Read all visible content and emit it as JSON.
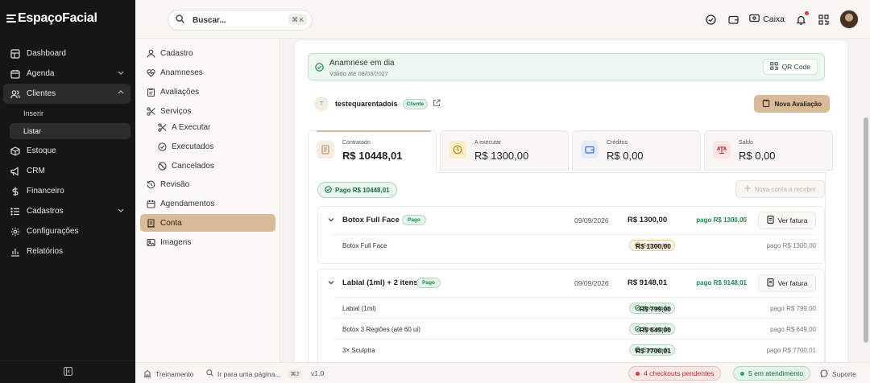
{
  "app": {
    "logo": "EspaçoFacial"
  },
  "sidebar": {
    "items": [
      {
        "label": "Dashboard"
      },
      {
        "label": "Agenda"
      },
      {
        "label": "Clientes"
      },
      {
        "label": "Estoque"
      },
      {
        "label": "CRM"
      },
      {
        "label": "Financeiro"
      },
      {
        "label": "Cadastros"
      },
      {
        "label": "Configurações"
      },
      {
        "label": "Relatórios"
      }
    ],
    "clientes_sub": [
      {
        "label": "Inserir"
      },
      {
        "label": "Listar"
      }
    ]
  },
  "topbar": {
    "search_placeholder": "Buscar...",
    "shortcut": "⌘ K",
    "caixa": "Caixa"
  },
  "submenu": {
    "items": [
      {
        "label": "Cadastro"
      },
      {
        "label": "Anamneses"
      },
      {
        "label": "Avaliações"
      },
      {
        "label": "Serviços"
      },
      {
        "label": "A Executar"
      },
      {
        "label": "Executados"
      },
      {
        "label": "Cancelados"
      },
      {
        "label": "Revisão"
      },
      {
        "label": "Agendamentos"
      },
      {
        "label": "Conta"
      },
      {
        "label": "Imagens"
      }
    ]
  },
  "anamnese": {
    "title": "Anamnese em dia",
    "subtitle": "Válido até 08/03/2027",
    "qr_label": "QR Code"
  },
  "client": {
    "initial": "T",
    "name": "testequarentadois",
    "badge": "Cliente",
    "new_eval": "Nova Avaliação"
  },
  "stats": [
    {
      "label": "Contratado",
      "value": "R$ 10448,01"
    },
    {
      "label": "A executar",
      "value": "R$ 1300,00"
    },
    {
      "label": "Créditos",
      "value": "R$ 0,00"
    },
    {
      "label": "Saldo",
      "value": "R$ 0,00"
    }
  ],
  "account": {
    "paid_total": "Pago R$ 10448,01",
    "new_receivable": "Nova conta a receber"
  },
  "groups": [
    {
      "title": "Botox Full Face",
      "status": "Pago",
      "date": "09/09/2026",
      "value": "R$ 1300,00",
      "paid": "pago R$ 1300,00",
      "invoice": "Ver fatura",
      "rows": [
        {
          "name": "Botox Full Face",
          "status": "A executar",
          "value": "R$ 1300,00",
          "paid": "pago R$ 1300,00"
        }
      ]
    },
    {
      "title": "Labial (1ml) + 2 itens",
      "status": "Pago",
      "date": "09/09/2026",
      "value": "R$ 9148,01",
      "paid": "pago R$ 9148,01",
      "invoice": "Ver fatura",
      "rows": [
        {
          "name": "Labial (1ml)",
          "status": "Executado",
          "value": "R$ 799,00",
          "paid": "pago R$ 799,00"
        },
        {
          "name": "Botox 3 Regiões (até 60 ui)",
          "status": "Executado",
          "value": "R$ 649,00",
          "paid": "pago R$ 649,00"
        },
        {
          "name": "3× Sculptra",
          "status": "Executado",
          "value": "R$ 7700,01",
          "paid": "pago R$ 7700,01"
        }
      ]
    }
  ],
  "bottombar": {
    "training": "Treinamento",
    "goto": "Ir para uma página...",
    "goto_kbd": "⌘J",
    "version": "v1.0",
    "checkouts": "4 checkouts pendentes",
    "attending": "5 em atendimento",
    "support": "Suporte"
  },
  "colors": {
    "accent": "#d9bc97",
    "success": "#1a8a4f",
    "danger": "#c62828",
    "sidebar_bg": "#161616"
  }
}
